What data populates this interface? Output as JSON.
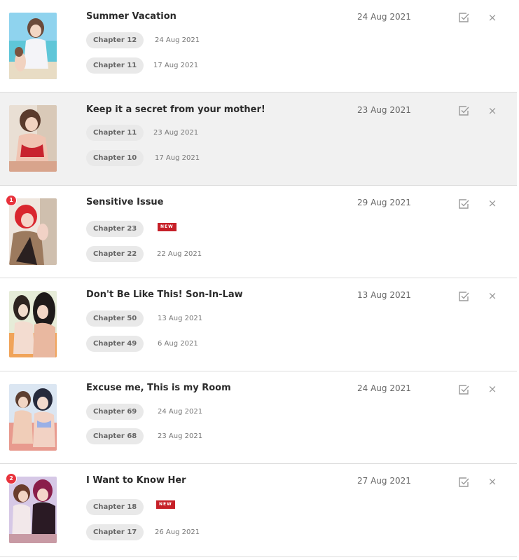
{
  "items": [
    {
      "title": "Summer Vacation",
      "date": "24 Aug 2021",
      "badge": "",
      "chapters": [
        {
          "label": "Chapter 12",
          "date": "24 Aug 2021",
          "new": false
        },
        {
          "label": "Chapter 11",
          "date": "17 Aug 2021",
          "new": false
        }
      ]
    },
    {
      "title": "Keep it a secret from your mother!",
      "date": "23 Aug 2021",
      "badge": "",
      "chapters": [
        {
          "label": "Chapter 11",
          "date": "23 Aug 2021",
          "new": false
        },
        {
          "label": "Chapter 10",
          "date": "17 Aug 2021",
          "new": false
        }
      ]
    },
    {
      "title": "Sensitive Issue",
      "date": "29 Aug 2021",
      "badge": "1",
      "chapters": [
        {
          "label": "Chapter 23",
          "date": "",
          "new": true,
          "new_label": "NEW"
        },
        {
          "label": "Chapter 22",
          "date": "22 Aug 2021",
          "new": false
        }
      ]
    },
    {
      "title": "Don't Be Like This! Son-In-Law",
      "date": "13 Aug 2021",
      "badge": "",
      "chapters": [
        {
          "label": "Chapter 50",
          "date": "13 Aug 2021",
          "new": false
        },
        {
          "label": "Chapter 49",
          "date": "6 Aug 2021",
          "new": false
        }
      ]
    },
    {
      "title": "Excuse me, This is my Room",
      "date": "24 Aug 2021",
      "badge": "",
      "chapters": [
        {
          "label": "Chapter 69",
          "date": "24 Aug 2021",
          "new": false
        },
        {
          "label": "Chapter 68",
          "date": "23 Aug 2021",
          "new": false
        }
      ]
    },
    {
      "title": "I Want to Know Her",
      "date": "27 Aug 2021",
      "badge": "2",
      "chapters": [
        {
          "label": "Chapter 18",
          "date": "",
          "new": true,
          "new_label": "NEW"
        },
        {
          "label": "Chapter 17",
          "date": "26 Aug 2021",
          "new": false
        }
      ]
    }
  ],
  "icons": {
    "check": "check-square-icon",
    "close": "close-icon"
  },
  "colors": {
    "new_tag": "#c62028",
    "badge": "#e8323c",
    "chip_bg": "#e9e9e9",
    "row_highlight": "#f1f1f1"
  }
}
